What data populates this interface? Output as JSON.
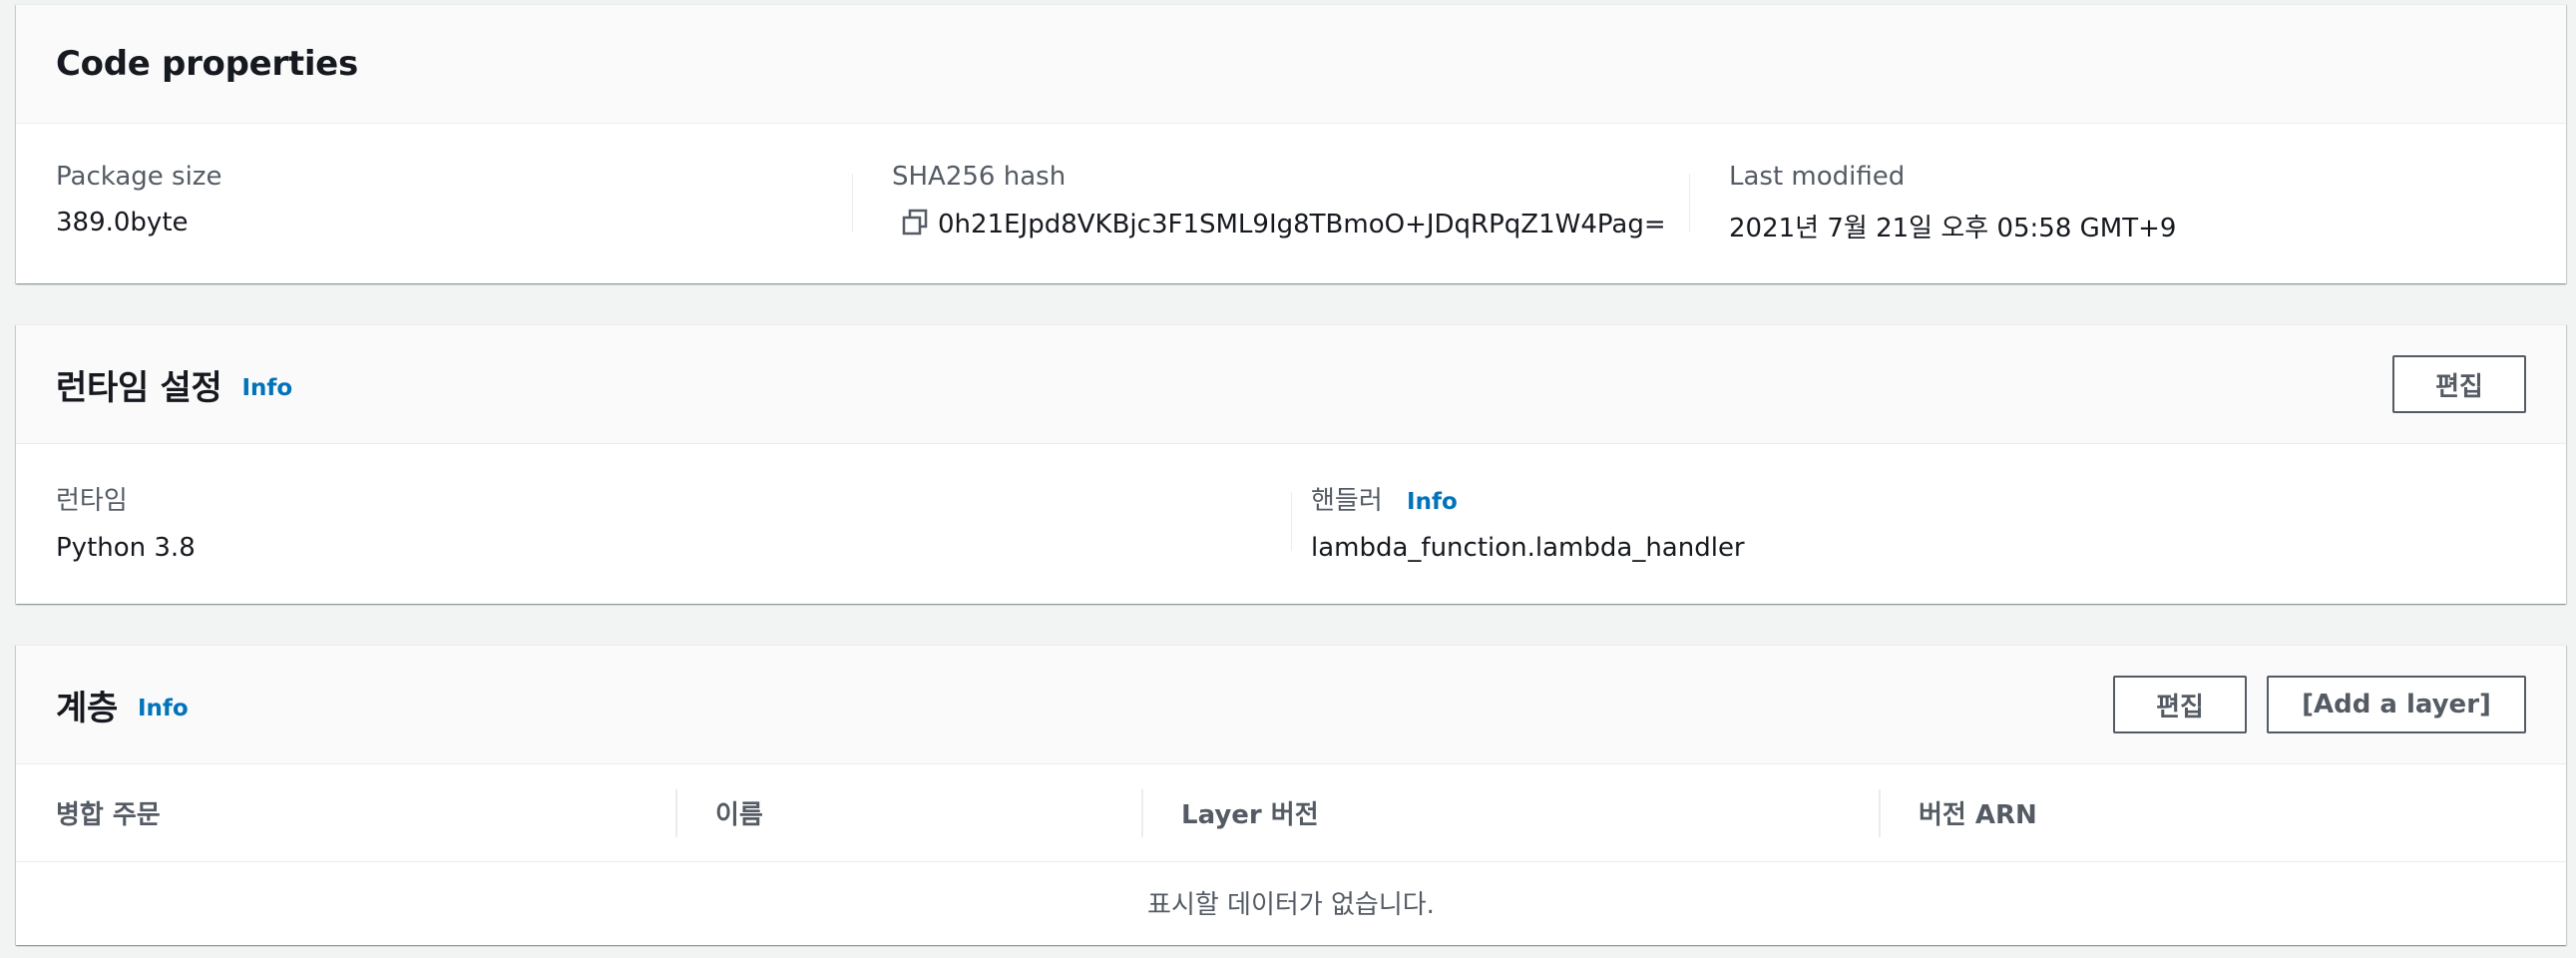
{
  "code_properties": {
    "title": "Code properties",
    "package_size_label": "Package size",
    "package_size_value": "389.0byte",
    "sha_label": "SHA256 hash",
    "sha_value": "0h21EJpd8VKBjc3F1SML9Ig8TBmoO+JDqRPqZ1W4Pag=",
    "last_modified_label": "Last modified",
    "last_modified_value": "2021년 7월 21일 오후 05:58 GMT+9"
  },
  "runtime_settings": {
    "title": "런타임 설정",
    "info": "Info",
    "edit_button": "편집",
    "runtime_label": "런타임",
    "runtime_value": "Python 3.8",
    "handler_label": "핸들러",
    "handler_info": "Info",
    "handler_value": "lambda_function.lambda_handler"
  },
  "layers": {
    "title": "계층",
    "info": "Info",
    "edit_button": "편집",
    "add_layer_button": "[Add a layer]",
    "columns": [
      "병합 주문",
      "이름",
      "Layer 버전",
      "버전 ARN"
    ],
    "empty_message": "표시할 데이터가 없습니다."
  },
  "icons": {
    "copy": "copy-icon"
  },
  "colors": {
    "link": "#0073bb",
    "header_bg": "#fafafa",
    "page_bg": "#f2f3f3"
  }
}
